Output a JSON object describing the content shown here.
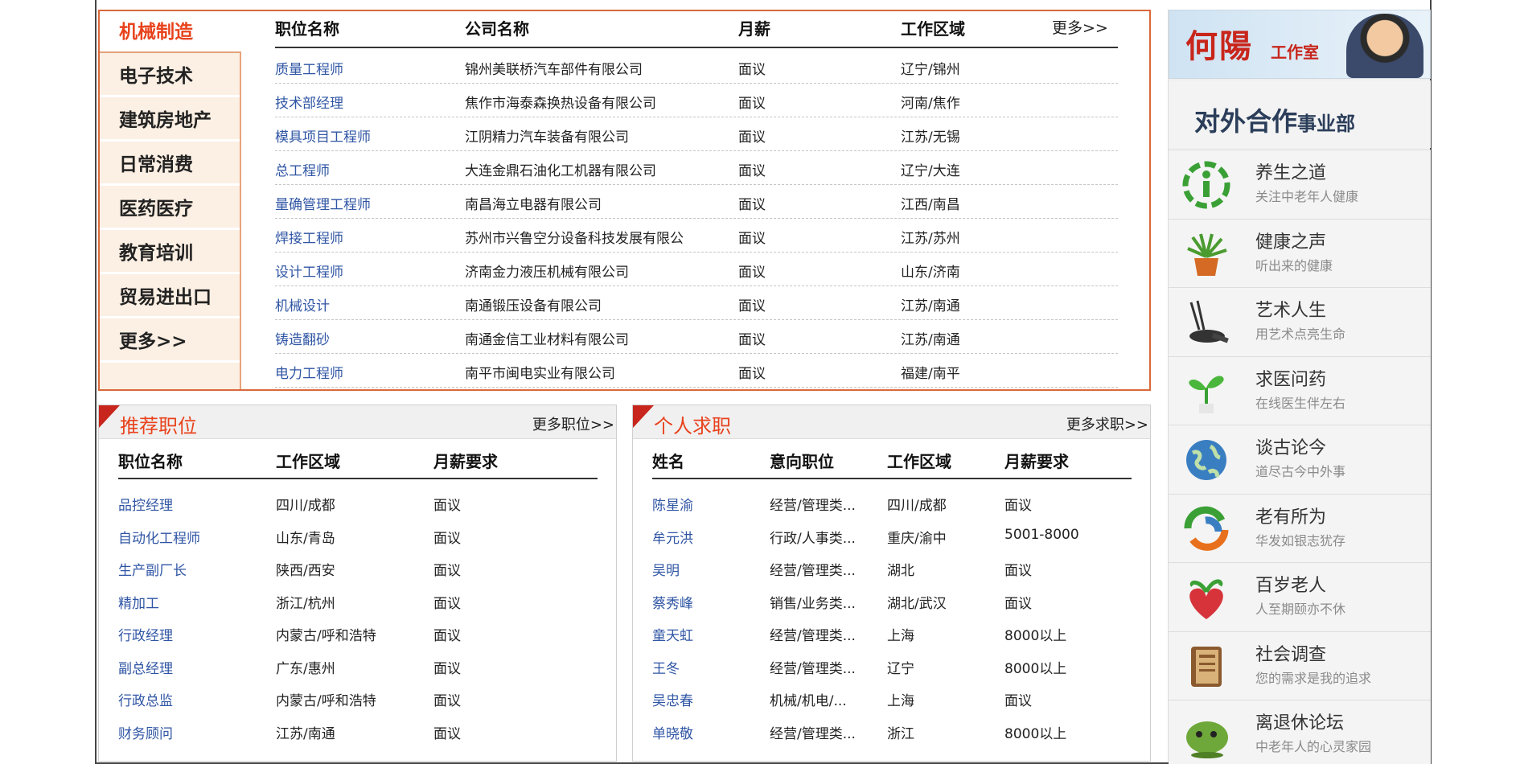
{
  "categories": {
    "items": [
      "机械制造",
      "电子技术",
      "建筑房地产",
      "日常消费",
      "医药医疗",
      "教育培训",
      "贸易进出口",
      "更多>>"
    ]
  },
  "jobs": {
    "headers": {
      "position": "职位名称",
      "company": "公司名称",
      "salary": "月薪",
      "area": "工作区域"
    },
    "more": "更多>>",
    "rows": [
      {
        "position": "质量工程师",
        "company": "锦州美联桥汽车部件有限公司",
        "salary": "面议",
        "area": "辽宁/锦州"
      },
      {
        "position": "技术部经理",
        "company": "焦作市海泰森换热设备有限公司",
        "salary": "面议",
        "area": "河南/焦作"
      },
      {
        "position": "模具项目工程师",
        "company": "江阴精力汽车装备有限公司",
        "salary": "面议",
        "area": "江苏/无锡"
      },
      {
        "position": "总工程师",
        "company": "大连金鼎石油化工机器有限公司",
        "salary": "面议",
        "area": "辽宁/大连"
      },
      {
        "position": "量确管理工程师",
        "company": "南昌海立电器有限公司",
        "salary": "面议",
        "area": "江西/南昌"
      },
      {
        "position": "焊接工程师",
        "company": "苏州市兴鲁空分设备科技发展有限公",
        "salary": "面议",
        "area": "江苏/苏州"
      },
      {
        "position": "设计工程师",
        "company": "济南金力液压机械有限公司",
        "salary": "面议",
        "area": "山东/济南"
      },
      {
        "position": "机械设计",
        "company": "南通锻压设备有限公司",
        "salary": "面议",
        "area": "江苏/南通"
      },
      {
        "position": "铸造翻砂",
        "company": "南通金信工业材料有限公司",
        "salary": "面议",
        "area": "江苏/南通"
      },
      {
        "position": "电力工程师",
        "company": "南平市闽电实业有限公司",
        "salary": "面议",
        "area": "福建/南平"
      }
    ]
  },
  "recommended": {
    "title": "推荐职位",
    "more": "更多职位>>",
    "headers": {
      "position": "职位名称",
      "area": "工作区域",
      "salary": "月薪要求"
    },
    "rows": [
      {
        "position": "品控经理",
        "area": "四川/成都",
        "salary": "面议"
      },
      {
        "position": "自动化工程师",
        "area": "山东/青岛",
        "salary": "面议"
      },
      {
        "position": "生产副厂长",
        "area": "陕西/西安",
        "salary": "面议"
      },
      {
        "position": "精加工",
        "area": "浙江/杭州",
        "salary": "面议"
      },
      {
        "position": "行政经理",
        "area": "内蒙古/呼和浩特",
        "salary": "面议"
      },
      {
        "position": "副总经理",
        "area": "广东/惠州",
        "salary": "面议"
      },
      {
        "position": "行政总监",
        "area": "内蒙古/呼和浩特",
        "salary": "面议"
      },
      {
        "position": "财务顾问",
        "area": "江苏/南通",
        "salary": "面议"
      }
    ]
  },
  "seekers": {
    "title": "个人求职",
    "more": "更多求职>>",
    "headers": {
      "name": "姓名",
      "intent": "意向职位",
      "area": "工作区域",
      "salary": "月薪要求"
    },
    "rows": [
      {
        "name": "陈星渝",
        "intent": "经营/管理类...",
        "area": "四川/成都",
        "salary": "面议"
      },
      {
        "name": "牟元洪",
        "intent": "行政/人事类...",
        "area": "重庆/渝中",
        "salary": "5001-8000"
      },
      {
        "name": "吴明",
        "intent": "经营/管理类...",
        "area": "湖北",
        "salary": "面议"
      },
      {
        "name": "蔡秀峰",
        "intent": "销售/业务类...",
        "area": "湖北/武汉",
        "salary": "面议"
      },
      {
        "name": "童天虹",
        "intent": "经营/管理类...",
        "area": "上海",
        "salary": "8000以上"
      },
      {
        "name": "王冬",
        "intent": "经营/管理类...",
        "area": "辽宁",
        "salary": "8000以上"
      },
      {
        "name": "吴忠春",
        "intent": "机械/机电/...",
        "area": "上海",
        "salary": "面议"
      },
      {
        "name": "单晓敬",
        "intent": "经营/管理类...",
        "area": "浙江",
        "salary": "8000以上"
      }
    ]
  },
  "sidebar": {
    "banner_logo": "何陽",
    "banner_sub": "工作室",
    "coop_main": "对外合作",
    "coop_small": "事业部",
    "services": [
      {
        "title": "养生之道",
        "subtitle": "关注中老年人健康",
        "icon": "health-logo-icon"
      },
      {
        "title": "健康之声",
        "subtitle": "听出来的健康",
        "icon": "potted-plant-icon"
      },
      {
        "title": "艺术人生",
        "subtitle": "用艺术点亮生命",
        "icon": "art-tools-icon"
      },
      {
        "title": "求医问药",
        "subtitle": "在线医生伴左右",
        "icon": "sprout-icon"
      },
      {
        "title": "谈古论今",
        "subtitle": "道尽古今中外事",
        "icon": "globe-icon"
      },
      {
        "title": "老有所为",
        "subtitle": "华发如银志犹存",
        "icon": "cycle-arrows-icon"
      },
      {
        "title": "百岁老人",
        "subtitle": "人至期颐亦不休",
        "icon": "heart-plant-icon"
      },
      {
        "title": "社会调查",
        "subtitle": "您的需求是我的追求",
        "icon": "notebook-icon"
      },
      {
        "title": "离退休论坛",
        "subtitle": "中老年人的心灵家园",
        "icon": "chat-character-icon"
      }
    ]
  },
  "colors": {
    "accent": "#e8421c",
    "link": "#2f55a4",
    "panel_border": "#d9693b",
    "category_bg": "#fcefe3"
  }
}
